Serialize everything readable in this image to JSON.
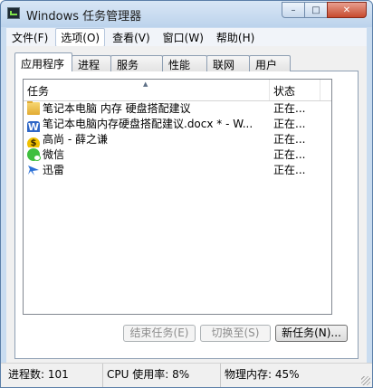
{
  "window": {
    "title": "Windows 任务管理器",
    "caption": {
      "minimize": "–",
      "maximize": "□",
      "close": "✕"
    }
  },
  "menu": [
    {
      "label": "文件(F)"
    },
    {
      "label": "选项(O)"
    },
    {
      "label": "查看(V)"
    },
    {
      "label": "窗口(W)"
    },
    {
      "label": "帮助(H)"
    }
  ],
  "tabs": [
    {
      "label": "应用程序"
    },
    {
      "label": "进程"
    },
    {
      "label": "服务"
    },
    {
      "label": "性能"
    },
    {
      "label": "联网"
    },
    {
      "label": "用户"
    }
  ],
  "table": {
    "columns": {
      "task": "任务",
      "status": "状态"
    },
    "sort_indicator": "▲",
    "rows": [
      {
        "icon": "folder-icon",
        "task": "笔记本电脑 内存 硬盘搭配建议",
        "status": "正在..."
      },
      {
        "icon": "wps-writer-icon",
        "task": "笔记本电脑内存硬盘搭配建议.docx * - W...",
        "status": "正在..."
      },
      {
        "icon": "gaosheng-icon",
        "task": "高尚 - 薛之谦",
        "status": "正在..."
      },
      {
        "icon": "wechat-icon",
        "task": "微信",
        "status": "正在..."
      },
      {
        "icon": "thunder-icon",
        "task": "迅雷",
        "status": "正在..."
      }
    ]
  },
  "buttons": {
    "end_task": "结束任务(E)",
    "switch_to": "切换至(S)",
    "new_task": "新任务(N)..."
  },
  "status_bar": {
    "processes": "进程数: 101",
    "cpu": "CPU 使用率: 8%",
    "memory": "物理内存: 45%"
  }
}
